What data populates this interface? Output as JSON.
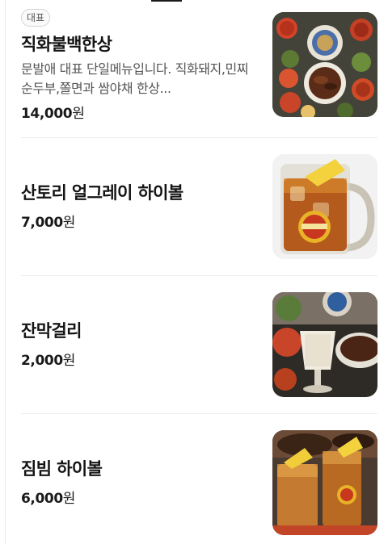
{
  "menu": {
    "items": [
      {
        "badge": "대표",
        "name": "직화불백한상",
        "description": "문발애 대표 단일메뉴입니다. 직화돼지,민찌순두부,쫄면과 쌈야채 한상...",
        "price": "14,000",
        "currency": "원",
        "image_icon": "korean-table-set-photo"
      },
      {
        "name": "산토리 얼그레이 하이볼",
        "price": "7,000",
        "currency": "원",
        "image_icon": "highball-mug-photo"
      },
      {
        "name": "잔막걸리",
        "price": "2,000",
        "currency": "원",
        "image_icon": "makgeolli-glass-photo"
      },
      {
        "name": "짐빔 하이볼",
        "price": "6,000",
        "currency": "원",
        "image_icon": "highball-glasses-photo"
      }
    ]
  },
  "colors": {
    "text_primary": "#141414",
    "text_secondary": "#555555",
    "divider": "#ededed",
    "badge_border": "#d4d4d4"
  }
}
